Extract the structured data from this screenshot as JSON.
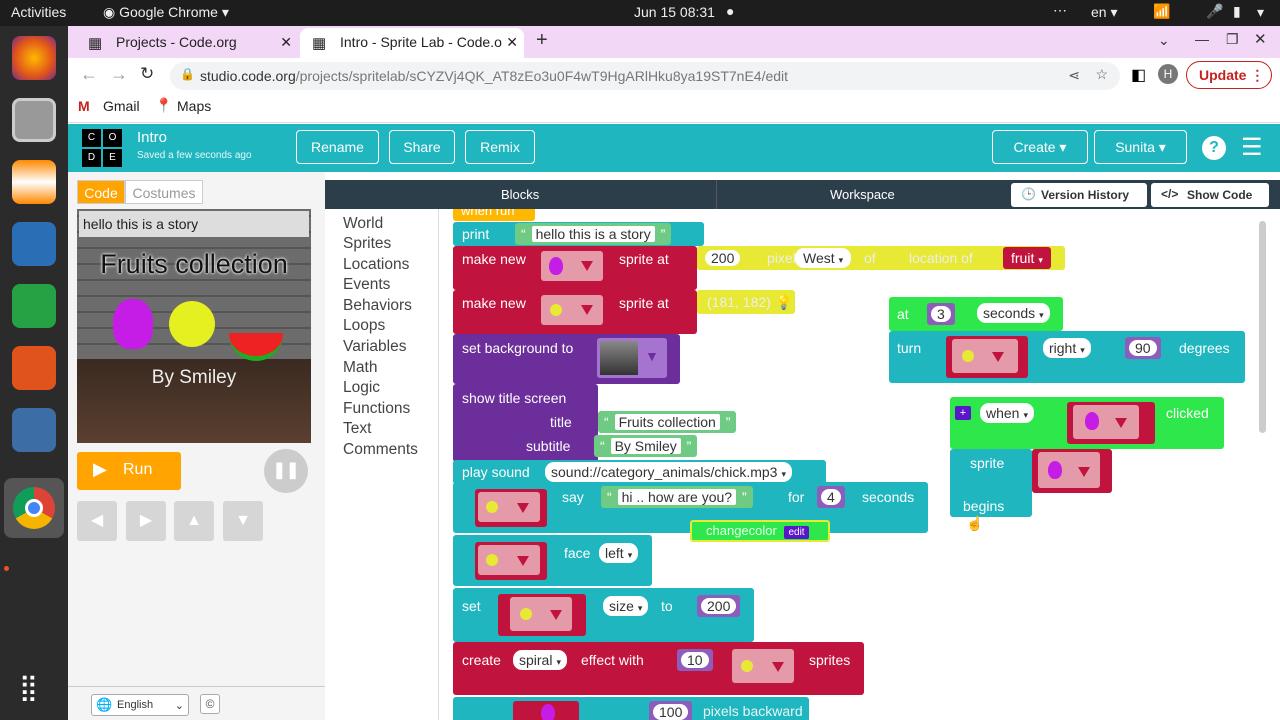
{
  "os": {
    "activities": "Activities",
    "app_menu": "Google Chrome",
    "datetime": "Jun 15  08:31",
    "lang": "en"
  },
  "browser": {
    "tabs": [
      {
        "label": "Projects - Code.org"
      },
      {
        "label": "Intro - Sprite Lab - Code.o"
      }
    ],
    "url_host": "studio.code.org",
    "url_path": "/projects/spritelab/sCYZVj4QK_AT8zEo3u0F4wT9HgARlHku8ya19ST7nE4/edit",
    "profile_initial": "H",
    "update_label": "Update",
    "bookmarks": [
      {
        "label": "Gmail"
      },
      {
        "label": "Maps"
      }
    ]
  },
  "header": {
    "logo_letters": [
      "C",
      "O",
      "D",
      "E"
    ],
    "project_name": "Intro",
    "saved_text": "Saved a few seconds ago",
    "rename": "Rename",
    "share": "Share",
    "remix": "Remix",
    "create": "Create",
    "user": "Sunita",
    "help": "?"
  },
  "left": {
    "tab_code": "Code",
    "tab_costumes": "Costumes",
    "stage_print": "hello this is a story",
    "stage_title": "Fruits collection",
    "stage_subtitle": "By Smiley",
    "run": "Run",
    "language": "English",
    "copyright": "©"
  },
  "workspace": {
    "blocks_label": "Blocks",
    "workspace_label": "Workspace",
    "version_history": "Version History",
    "show_code": "Show Code",
    "categories": [
      "World",
      "Sprites",
      "Locations",
      "Events",
      "Behaviors",
      "Loops",
      "Variables",
      "Math",
      "Logic",
      "Functions",
      "Text",
      "Comments"
    ]
  },
  "blocks": {
    "when_run": "when run",
    "print": "print",
    "print_text": "hello this is a story",
    "make_new": "make new",
    "sprite_at": "sprite at",
    "pixels_val": "200",
    "pixels": "pixels",
    "dir": "West",
    "of": "of",
    "location_of": "location of",
    "fruit": "fruit",
    "coords": "(181, 182)",
    "set_bg": "set background to",
    "show_title": "show title screen",
    "title": "title",
    "subtitle": "subtitle",
    "title_text": "Fruits collection",
    "subtitle_text": "By Smiley",
    "play_sound": "play sound",
    "sound": "sound://category_animals/chick.mp3",
    "say": "say",
    "say_text": "hi .. how are you?",
    "for": "for",
    "for_val": "4",
    "seconds": "seconds",
    "changecolor": "changecolor",
    "edit": "edit",
    "face": "face",
    "face_dir": "left",
    "set": "set",
    "size": "size",
    "to": "to",
    "size_val": "200",
    "create": "create",
    "effect": "spiral",
    "effect_with": "effect with",
    "effect_num": "10",
    "sprites": "sprites",
    "at": "at",
    "at_val": "3",
    "at_seconds": "seconds",
    "turn": "turn",
    "turn_dir": "right",
    "turn_val": "90",
    "degrees": "degrees",
    "when": "when",
    "clicked": "clicked",
    "sprite": "sprite",
    "begins": "begins",
    "partial_val": "100",
    "partial_text": "pixels backward"
  }
}
